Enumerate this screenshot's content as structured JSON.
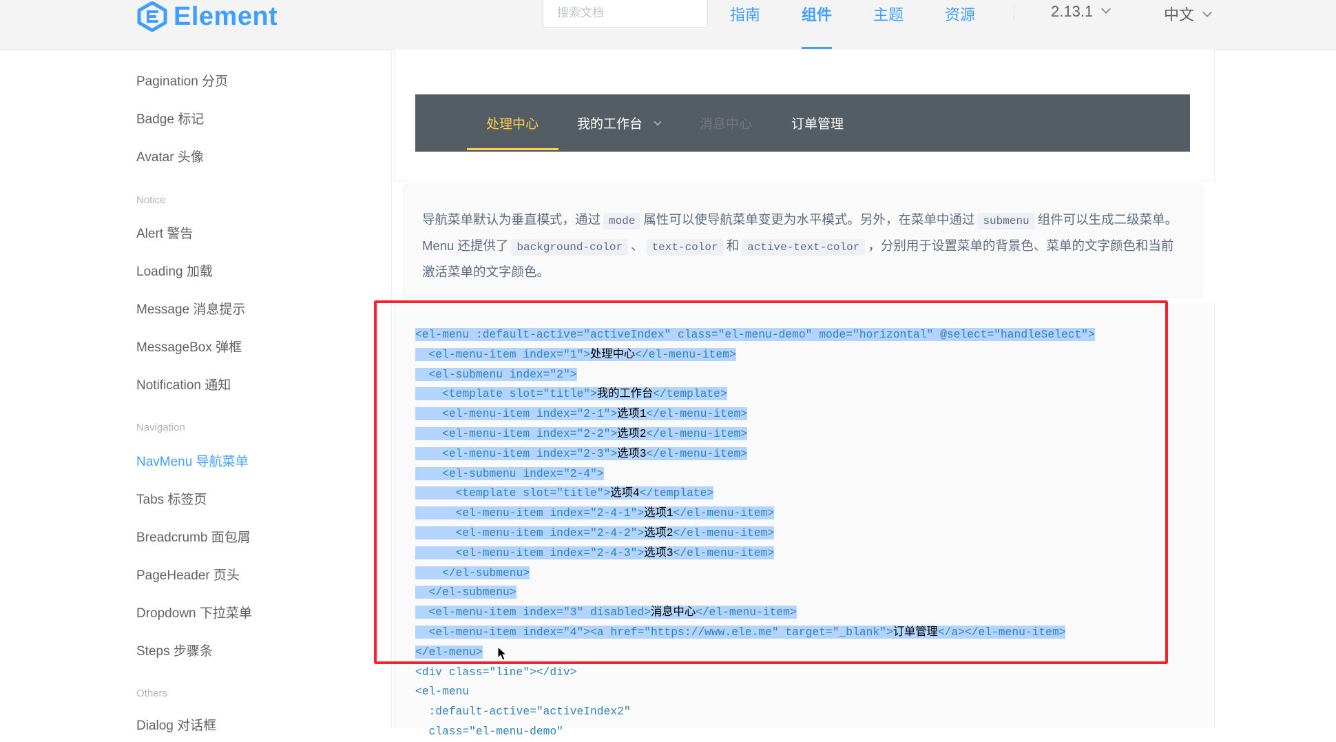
{
  "header": {
    "brand": "Element",
    "search_placeholder": "搜索文档",
    "nav": [
      {
        "label": "指南"
      },
      {
        "label": "组件"
      },
      {
        "label": "主题"
      },
      {
        "label": "资源"
      }
    ],
    "version": "2.13.1",
    "language": "中文"
  },
  "sidebar": {
    "items": [
      {
        "label": "Pagination 分页"
      },
      {
        "label": "Badge 标记"
      },
      {
        "label": "Avatar 头像"
      }
    ],
    "groups": [
      {
        "title": "Notice",
        "items": [
          {
            "label": "Alert 警告"
          },
          {
            "label": "Loading 加载"
          },
          {
            "label": "Message 消息提示"
          },
          {
            "label": "MessageBox 弹框"
          },
          {
            "label": "Notification 通知"
          }
        ]
      },
      {
        "title": "Navigation",
        "items": [
          {
            "label": "NavMenu 导航菜单"
          },
          {
            "label": "Tabs 标签页"
          },
          {
            "label": "Breadcrumb 面包屑"
          },
          {
            "label": "PageHeader 页头"
          },
          {
            "label": "Dropdown 下拉菜单"
          },
          {
            "label": "Steps 步骤条"
          }
        ]
      },
      {
        "title": "Others",
        "items": [
          {
            "label": "Dialog 对话框"
          }
        ]
      }
    ]
  },
  "demo_menu": {
    "items": [
      {
        "label": "处理中心"
      },
      {
        "label": "我的工作台"
      },
      {
        "label": "消息中心"
      },
      {
        "label": "订单管理"
      }
    ],
    "colors": {
      "background": "#545c64",
      "text": "#ffffff",
      "active": "#ffd04b"
    }
  },
  "description": {
    "p1": "导航菜单默认为垂直模式，通过",
    "c1": "mode",
    "p2": "属性可以使导航菜单变更为水平模式。另外，在菜单中通过",
    "c2": "submenu",
    "p3": "组件可以生成二级菜单。Menu 还提供了",
    "c3": "background-color",
    "p4": "、",
    "c4": "text-color",
    "p5": "和",
    "c5": "active-text-color",
    "p6": "，分别用于设置菜单的背景色、菜单的文字颜色和当前激活菜单的文字颜色。"
  },
  "code": {
    "lines": [
      [
        {
          "t": "<el-menu :default-active=\"activeIndex\" class=\"el-menu-demo\" mode=\"horizontal\" @select=\"handleSelect\">"
        }
      ],
      [
        {
          "t": "  <el-menu-item index=\"1\">"
        },
        {
          "t": "处理中心",
          "k": "text"
        },
        {
          "t": "</el-menu-item>"
        }
      ],
      [
        {
          "t": "  <el-submenu index=\"2\">"
        }
      ],
      [
        {
          "t": "    <template slot=\"title\">"
        },
        {
          "t": "我的工作台",
          "k": "text"
        },
        {
          "t": "</template>"
        }
      ],
      [
        {
          "t": "    <el-menu-item index=\"2-1\">"
        },
        {
          "t": "选项1",
          "k": "text"
        },
        {
          "t": "</el-menu-item>"
        }
      ],
      [
        {
          "t": "    <el-menu-item index=\"2-2\">"
        },
        {
          "t": "选项2",
          "k": "text"
        },
        {
          "t": "</el-menu-item>"
        }
      ],
      [
        {
          "t": "    <el-menu-item index=\"2-3\">"
        },
        {
          "t": "选项3",
          "k": "text"
        },
        {
          "t": "</el-menu-item>"
        }
      ],
      [
        {
          "t": "    <el-submenu index=\"2-4\">"
        }
      ],
      [
        {
          "t": "      <template slot=\"title\">"
        },
        {
          "t": "选项4",
          "k": "text"
        },
        {
          "t": "</template>"
        }
      ],
      [
        {
          "t": "      <el-menu-item index=\"2-4-1\">"
        },
        {
          "t": "选项1",
          "k": "text"
        },
        {
          "t": "</el-menu-item>"
        }
      ],
      [
        {
          "t": "      <el-menu-item index=\"2-4-2\">"
        },
        {
          "t": "选项2",
          "k": "text"
        },
        {
          "t": "</el-menu-item>"
        }
      ],
      [
        {
          "t": "      <el-menu-item index=\"2-4-3\">"
        },
        {
          "t": "选项3",
          "k": "text"
        },
        {
          "t": "</el-menu-item>"
        }
      ],
      [
        {
          "t": "    </el-submenu>"
        }
      ],
      [
        {
          "t": "  </el-submenu>"
        }
      ],
      [
        {
          "t": "  <el-menu-item index=\"3\" disabled>"
        },
        {
          "t": "消息中心",
          "k": "text"
        },
        {
          "t": "</el-menu-item>"
        }
      ],
      [
        {
          "t": "  <el-menu-item index=\"4\"><a href=\"https://www.ele.me\" target=\"_blank\">"
        },
        {
          "t": "订单管理",
          "k": "text"
        },
        {
          "t": "</a></el-menu-item>"
        }
      ],
      [
        {
          "t": "</el-menu>"
        }
      ]
    ],
    "plain_lines": [
      "<div class=\"line\"></div>",
      "<el-menu",
      "  :default-active=\"activeIndex2\"",
      "  class=\"el-menu-demo\""
    ]
  }
}
